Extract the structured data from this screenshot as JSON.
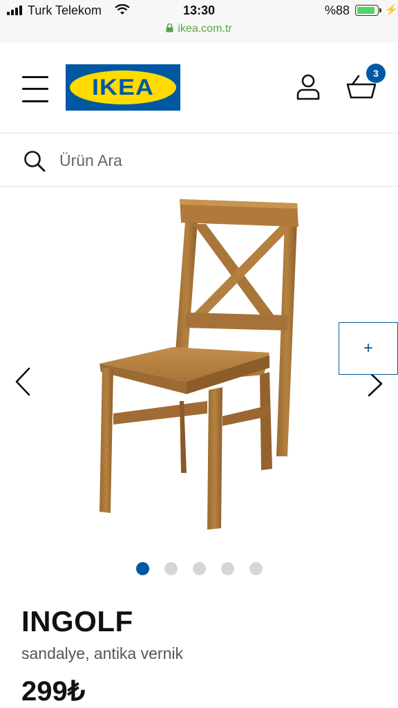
{
  "status_bar": {
    "carrier": "Turk Telekom",
    "time": "13:30",
    "battery_percent": "%88",
    "battery_level": 0.88,
    "url": "ikea.com.tr",
    "battery_color": "#4cd964",
    "url_color": "#5aa146"
  },
  "header": {
    "logo_text": "IKEA",
    "cart_count": "3",
    "icons": [
      "menu-icon",
      "user-icon",
      "cart-icon"
    ],
    "brand_blue": "#0058a3",
    "brand_yellow": "#ffdb00"
  },
  "search": {
    "placeholder": "Ürün Ara"
  },
  "carousel": {
    "add_label": "+",
    "total_images": 5,
    "active_index": 0
  },
  "product": {
    "name": "INGOLF",
    "description": "sandalye, antika vernik",
    "price": "299₺"
  }
}
